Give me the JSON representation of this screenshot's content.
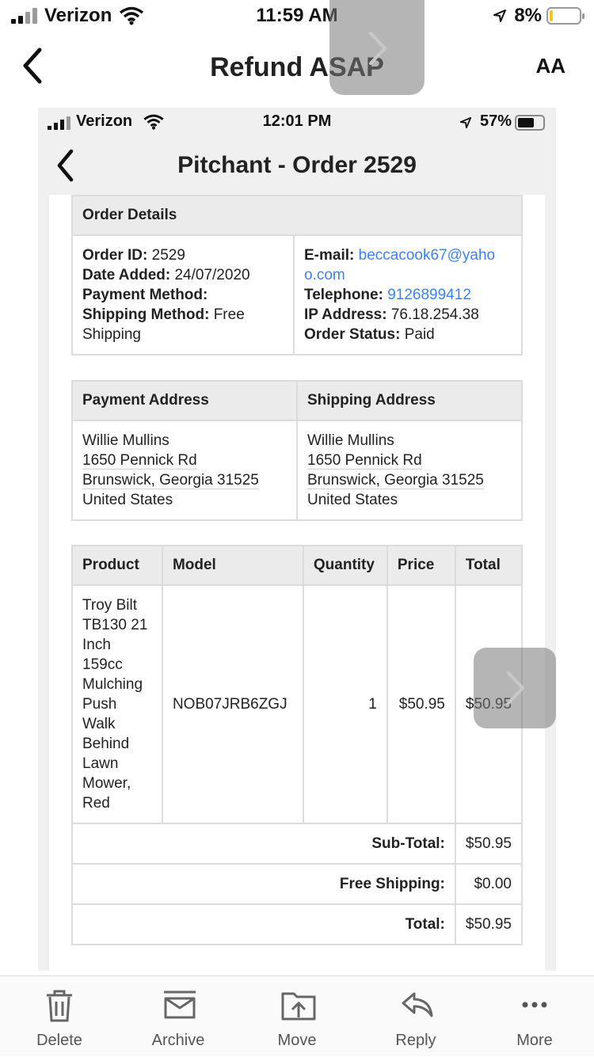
{
  "status_bar": {
    "carrier": "Verizon",
    "time": "11:59 AM",
    "battery": "8%"
  },
  "nav": {
    "title": "Refund ASAP",
    "text_size_label": "AA"
  },
  "embedded": {
    "status_bar": {
      "carrier": "Verizon",
      "time": "12:01 PM",
      "battery": "57%"
    },
    "nav": {
      "title": "Pitchant - Order 2529"
    },
    "order_details": {
      "header": "Order Details",
      "order_id_label": "Order ID:",
      "order_id": "2529",
      "date_label": "Date Added:",
      "date": "24/07/2020",
      "payment_method_label": "Payment Method:",
      "shipping_method_label": "Shipping Method:",
      "shipping_method_1": "Free",
      "shipping_method_2": "Shipping",
      "email_label": "E-mail:",
      "email_1": "beccacook67@yaho",
      "email_2": "o.com",
      "telephone_label": "Telephone:",
      "telephone": "9126899412",
      "ip_label": "IP Address:",
      "ip": "76.18.254.38",
      "status_label": "Order Status:",
      "status": "Paid"
    },
    "addresses": {
      "payment_header": "Payment Address",
      "shipping_header": "Shipping Address",
      "payment": [
        "Willie Mullins",
        "1650 Pennick Rd",
        "Brunswick, Georgia 31525",
        "United States"
      ],
      "shipping": [
        "Willie Mullins",
        "1650 Pennick Rd",
        "Brunswick, Georgia 31525",
        "United States"
      ]
    },
    "products": {
      "headers": {
        "product": "Product",
        "model": "Model",
        "quantity": "Quantity",
        "price": "Price",
        "total": "Total"
      },
      "rows": [
        {
          "product_lines": [
            "Troy Bilt",
            "TB130 21",
            "Inch",
            "159cc",
            "Mulching",
            "Push",
            "Walk",
            "Behind",
            "Lawn",
            "Mower,",
            "Red"
          ],
          "model": "NOB07JRB6ZGJ",
          "quantity": "1",
          "price": "$50.95",
          "total": "$50.95"
        }
      ],
      "subtotal_label": "Sub-Total:",
      "subtotal": "$50.95",
      "shipping_label": "Free Shipping:",
      "shipping": "$0.00",
      "total_label": "Total:",
      "total": "$50.95"
    }
  },
  "toolbar": {
    "delete": "Delete",
    "archive": "Archive",
    "move": "Move",
    "reply": "Reply",
    "more": "More"
  }
}
